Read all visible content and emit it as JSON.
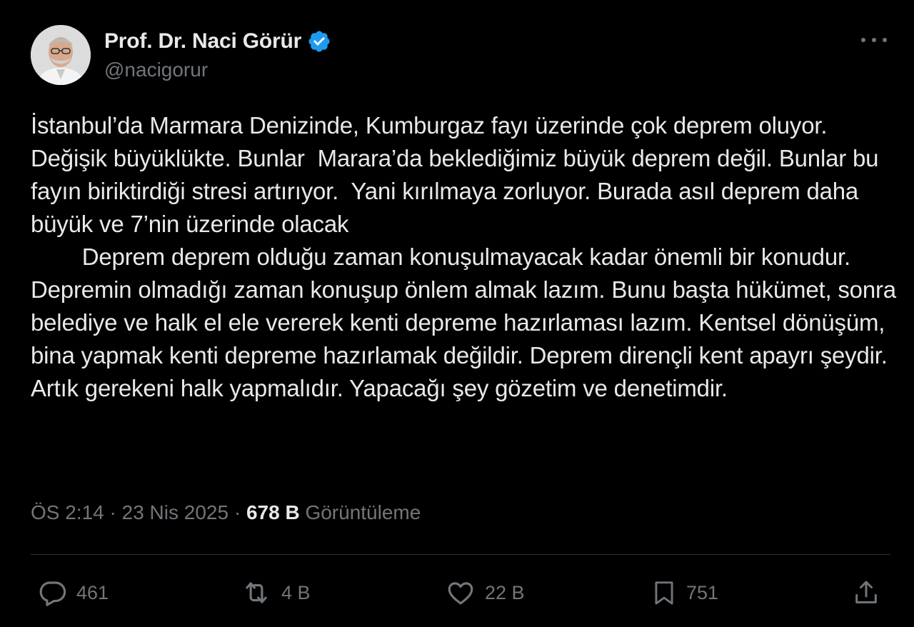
{
  "author": {
    "display_name": "Prof. Dr. Naci Görür",
    "handle": "@nacigorur",
    "verified_icon": "verified-badge-icon",
    "verified_color": "#1d9bf0"
  },
  "tweet": {
    "text": "İstanbul’da Marmara Denizinde, Kumburgaz fayı üzerinde çok deprem oluyor. Değişik büyüklükte. Bunlar  Marara’da beklediğimiz büyük deprem değil. Bunlar bu fayın biriktirdiği stresi artırıyor.  Yani kırılmaya zorluyor. Burada asıl deprem daha büyük ve 7’nin üzerinde olacak\n        Deprem deprem olduğu zaman konuşulmayacak kadar önemli bir konudur. Depremin olmadığı zaman konuşup önlem almak lazım. Bunu başta hükümet, sonra belediye ve halk el ele vererek kenti depreme hazırlaması lazım. Kentsel dönüşüm, bina yapmak kenti depreme hazırlamak değildir. Deprem dirençli kent apayrı şeydir. Artık gerekeni halk yapmalıdır. Yapacağı şey gözetim ve denetimdir."
  },
  "meta": {
    "time": "ÖS 2:14",
    "separator": " · ",
    "date": "23 Nis 2025",
    "views_count": "678 B",
    "views_label": "Görüntüleme"
  },
  "actions": {
    "replies": "461",
    "reposts": "4 B",
    "likes": "22 B",
    "bookmarks": "751"
  },
  "colors": {
    "background": "#000000",
    "text": "#e7e9ea",
    "secondary": "#71767b",
    "divider": "#2f3336"
  }
}
